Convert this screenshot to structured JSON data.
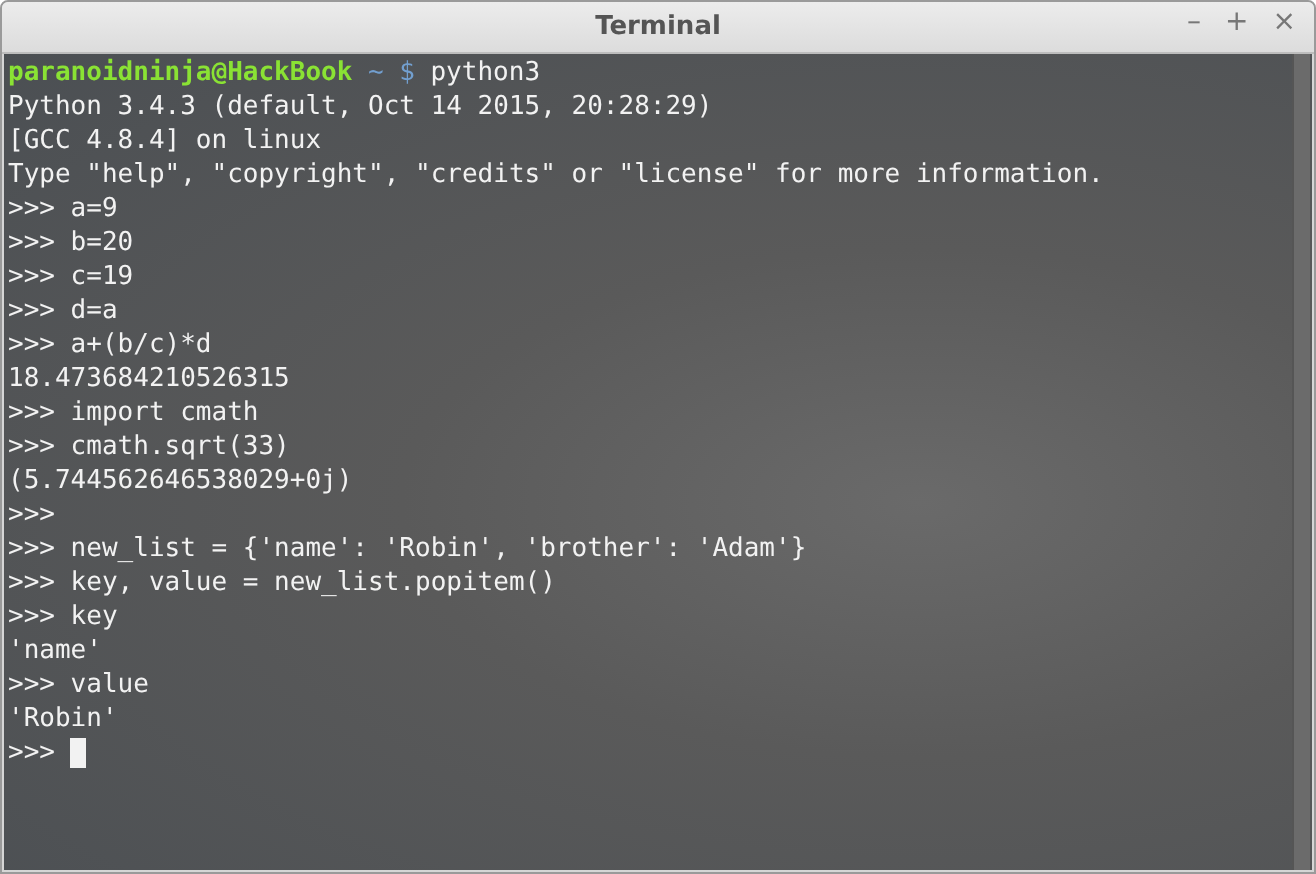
{
  "window": {
    "title": "Terminal",
    "controls": [
      "–",
      "+",
      "×"
    ]
  },
  "terminal": {
    "lines": [
      {
        "kind": "shell_prompt",
        "user_host": "paranoidninja@HackBook",
        "path": "~",
        "symbol": "$",
        "command": "python3"
      },
      {
        "kind": "output",
        "text": "Python 3.4.3 (default, Oct 14 2015, 20:28:29)"
      },
      {
        "kind": "output",
        "text": "[GCC 4.8.4] on linux"
      },
      {
        "kind": "output",
        "text": "Type \"help\", \"copyright\", \"credits\" or \"license\" for more information."
      },
      {
        "kind": "output",
        "text": ">>> a=9"
      },
      {
        "kind": "output",
        "text": ">>> b=20"
      },
      {
        "kind": "output",
        "text": ">>> c=19"
      },
      {
        "kind": "output",
        "text": ">>> d=a"
      },
      {
        "kind": "output",
        "text": ">>> a+(b/c)*d"
      },
      {
        "kind": "output",
        "text": "18.473684210526315"
      },
      {
        "kind": "output",
        "text": ">>> import cmath"
      },
      {
        "kind": "output",
        "text": ">>> cmath.sqrt(33)"
      },
      {
        "kind": "output",
        "text": "(5.744562646538029+0j)"
      },
      {
        "kind": "output",
        "text": ">>>"
      },
      {
        "kind": "output",
        "text": ">>> new_list = {'name': 'Robin', 'brother': 'Adam'}"
      },
      {
        "kind": "output",
        "text": ">>> key, value = new_list.popitem()"
      },
      {
        "kind": "output",
        "text": ">>> key"
      },
      {
        "kind": "output",
        "text": "'name'"
      },
      {
        "kind": "output",
        "text": ">>> value"
      },
      {
        "kind": "output",
        "text": "'Robin'"
      },
      {
        "kind": "input",
        "text": ">>>"
      }
    ]
  }
}
